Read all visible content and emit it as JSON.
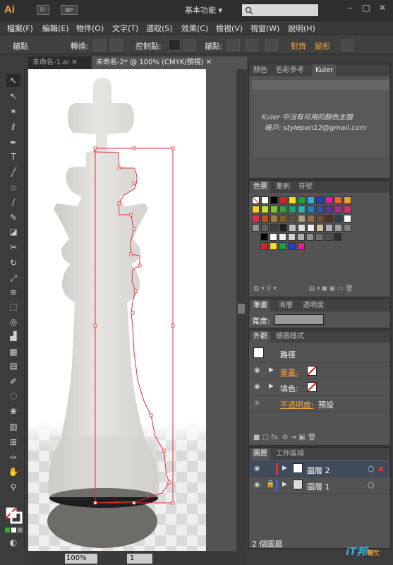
{
  "app": {
    "logo": "Ai",
    "workspace": "基本功能 ▾",
    "br": "Br",
    "win_min": "–",
    "win_max": "□",
    "win_close": "✕"
  },
  "menu": [
    "檔案(F)",
    "編輯(E)",
    "物件(O)",
    "文字(T)",
    "選取(S)",
    "效果(C)",
    "檢視(V)",
    "視窗(W)",
    "說明(H)"
  ],
  "control": {
    "label": "錨點",
    "convert": "轉換:",
    "handles": "控制點:",
    "anchors": "錨點:",
    "align": "對齊",
    "transform": "變形"
  },
  "tabs": [
    {
      "label": "未命名-1.ai"
    },
    {
      "label": "未命名-2* @ 100% (CMYK/預視)"
    }
  ],
  "status": {
    "zoom": "100%",
    "page": "1"
  },
  "kuler": {
    "tabs": [
      "顏色",
      "色彩參考",
      "Kuler"
    ],
    "msg1": "Kuler 中沒有可用的顏色主題",
    "msg2": "帳戶: stylepan12@gmail.com"
  },
  "swatches": {
    "tabs": [
      "色票",
      "筆刷",
      "符號"
    ]
  },
  "stroke": {
    "tabs": [
      "筆畫",
      "漸層",
      "透明度"
    ],
    "weight_label": "寬度:"
  },
  "appearance": {
    "tabs": [
      "外觀",
      "繪圖樣式"
    ],
    "path_label": "路徑",
    "stroke_label": "筆畫:",
    "fill_label": "填色:",
    "opacity_label": "不透明度:",
    "opacity_value": "預設"
  },
  "layers": {
    "tabs": [
      "圖層",
      "工作區域"
    ],
    "items": [
      {
        "name": "圖層 2",
        "color": "#e03030"
      },
      {
        "name": "圖層 1",
        "color": "#4060e0"
      }
    ],
    "count": "2 個圖層"
  },
  "watermark": {
    "brand": "iT邦",
    "sub": "幫忙"
  },
  "colors": {
    "accent": "#f0a040",
    "selection": "#e04040"
  }
}
